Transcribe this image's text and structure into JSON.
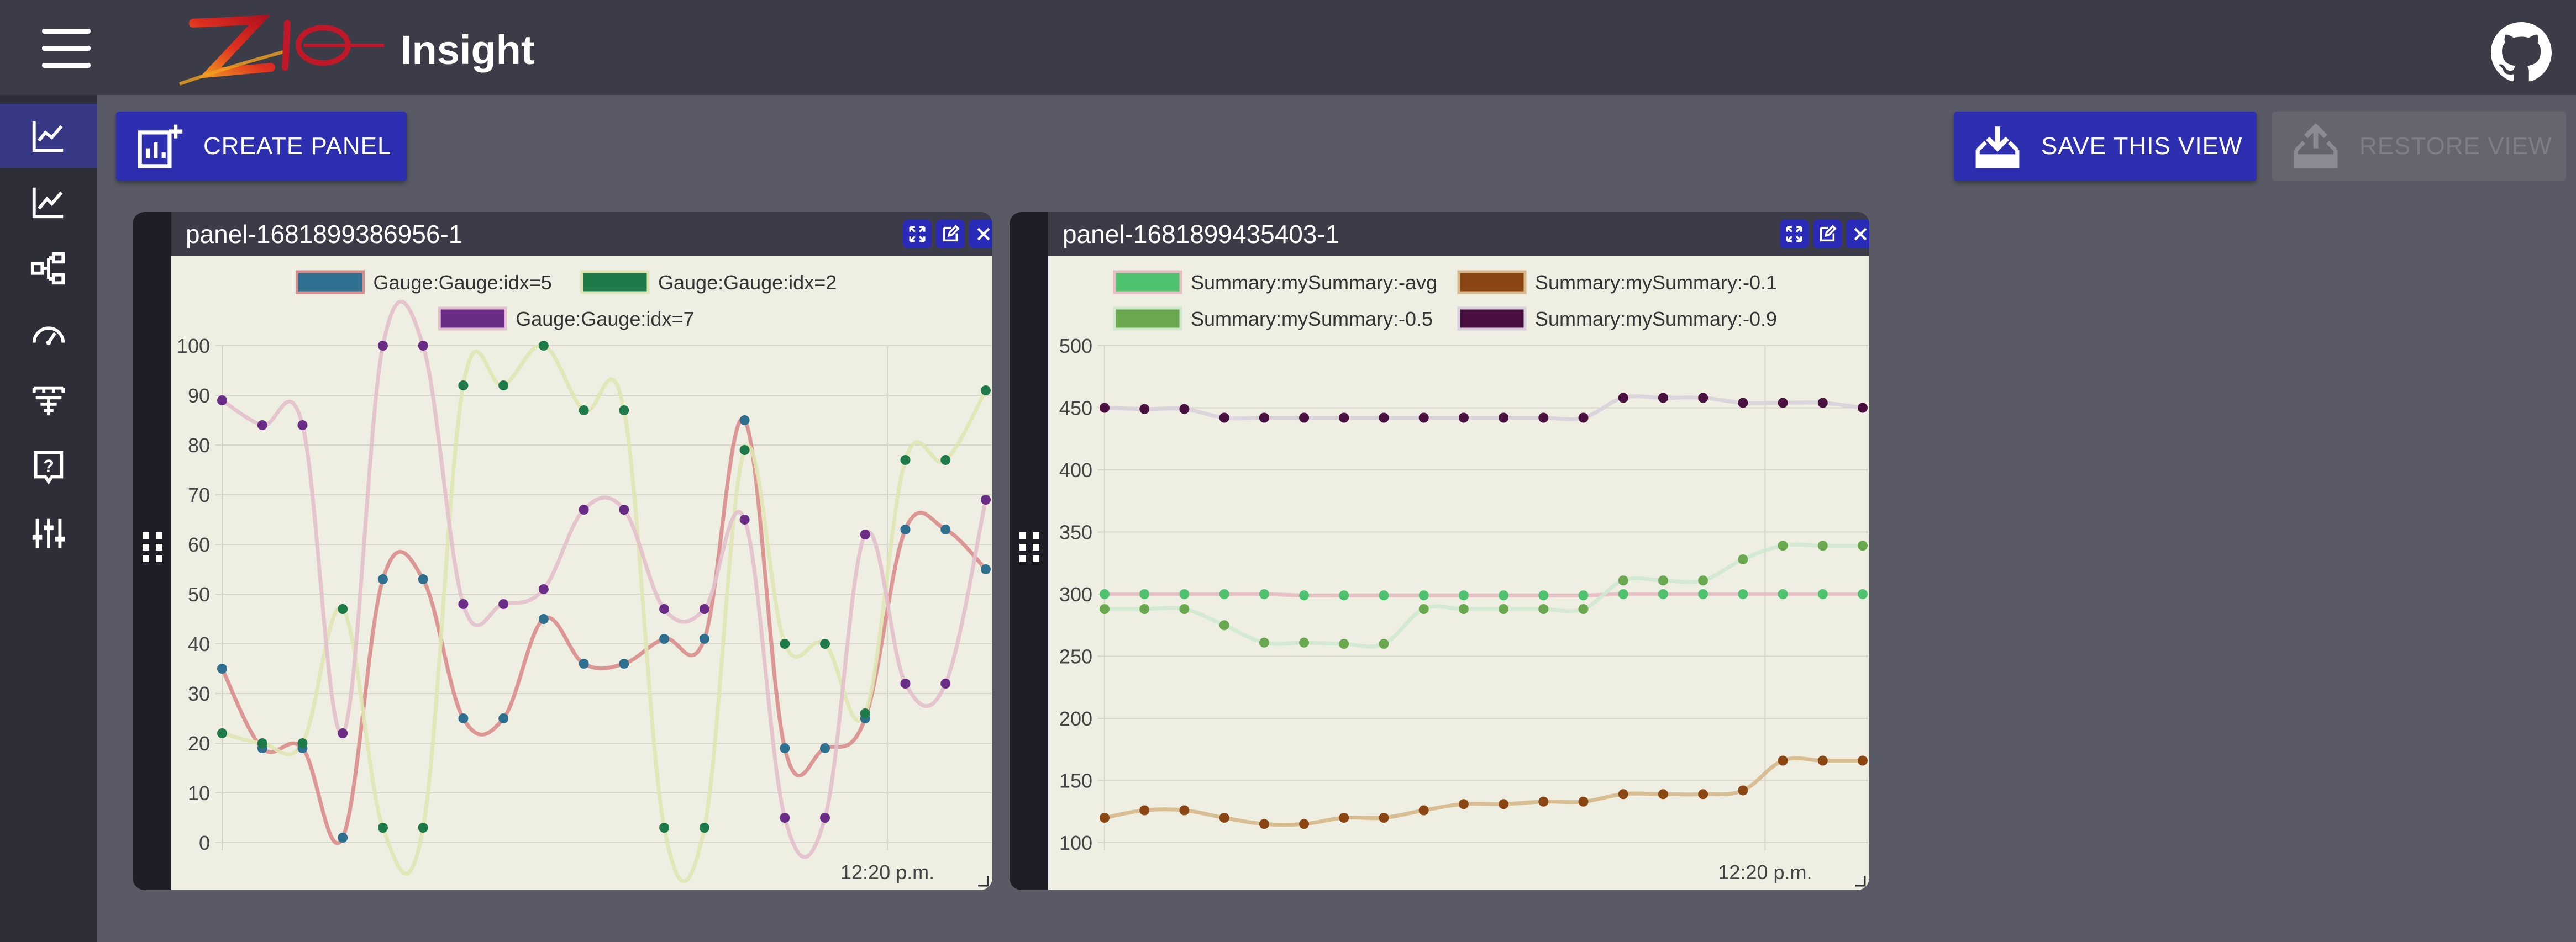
{
  "header": {
    "app_title": "Insight",
    "logo_text": "ZIO"
  },
  "sidebar": {
    "items": [
      {
        "icon": "line-chart-icon",
        "active": true
      },
      {
        "icon": "line-chart-icon",
        "active": false
      },
      {
        "icon": "hierarchy-icon",
        "active": false
      },
      {
        "icon": "gauge-icon",
        "active": false
      },
      {
        "icon": "tree-diagram-icon",
        "active": false
      },
      {
        "icon": "help-icon",
        "active": false
      },
      {
        "icon": "sliders-icon",
        "active": false
      }
    ]
  },
  "toolbar": {
    "create_panel": "CREATE PANEL",
    "save_view": "SAVE THIS VIEW",
    "restore_view": "RESTORE VIEW"
  },
  "colors": {
    "accent": "#2e2eb0",
    "topbar": "#3c3c48",
    "background": "#5a5a66",
    "chart_bg": "#eeeee2"
  },
  "panels": [
    {
      "title": "panel-1681899386956-1",
      "x_tick": "12:20 p.m."
    },
    {
      "title": "panel-1681899435403-1",
      "x_tick": "12:20 p.m."
    }
  ],
  "chart_data": [
    {
      "type": "line",
      "ylim": [
        0,
        100
      ],
      "y_ticks": [
        0,
        10,
        20,
        30,
        40,
        50,
        60,
        70,
        80,
        90,
        100
      ],
      "x_tick_labels": [
        "12:20 p.m."
      ],
      "grid": true,
      "legend_position": "top",
      "series": [
        {
          "name": "Gauge:Gauge:idx=5",
          "color": "#2f6f8f",
          "line_color": "#d98c8c",
          "values": [
            35,
            19,
            19,
            1,
            53,
            53,
            25,
            25,
            45,
            36,
            36,
            41,
            41,
            85,
            19,
            19,
            25,
            63,
            63,
            55
          ]
        },
        {
          "name": "Gauge:Gauge:idx=2",
          "color": "#1f7a4a",
          "line_color": "#dfe6b4",
          "values": [
            22,
            20,
            20,
            47,
            3,
            3,
            92,
            92,
            100,
            87,
            87,
            3,
            3,
            79,
            40,
            40,
            26,
            77,
            77,
            91
          ]
        },
        {
          "name": "Gauge:Gauge:idx=7",
          "color": "#6a2c86",
          "line_color": "#e2c0cc",
          "values": [
            89,
            84,
            84,
            22,
            100,
            100,
            48,
            48,
            51,
            67,
            67,
            47,
            47,
            65,
            5,
            5,
            62,
            32,
            32,
            69
          ]
        }
      ]
    },
    {
      "type": "line",
      "ylim": [
        100,
        500
      ],
      "y_ticks": [
        100,
        150,
        200,
        250,
        300,
        350,
        400,
        450,
        500
      ],
      "x_tick_labels": [
        "12:20 p.m."
      ],
      "grid": true,
      "legend_position": "top",
      "series": [
        {
          "name": "Summary:mySummary:-avg",
          "color": "#4ec26f",
          "line_color": "#e8bcc4",
          "values": [
            300,
            300,
            300,
            300,
            300,
            299,
            299,
            299,
            299,
            299,
            299,
            299,
            299,
            300,
            300,
            300,
            300,
            300,
            300,
            300
          ]
        },
        {
          "name": "Summary:mySummary:-0.1",
          "color": "#8b4513",
          "line_color": "#d6b88c",
          "values": [
            120,
            126,
            126,
            120,
            115,
            115,
            120,
            120,
            126,
            131,
            131,
            133,
            133,
            139,
            139,
            139,
            142,
            166,
            166,
            166
          ]
        },
        {
          "name": "Summary:mySummary:-0.5",
          "color": "#6aa84f",
          "line_color": "#cfe8cf",
          "values": [
            288,
            288,
            288,
            275,
            261,
            261,
            260,
            260,
            288,
            288,
            288,
            288,
            288,
            311,
            311,
            311,
            328,
            339,
            339,
            339
          ]
        },
        {
          "name": "Summary:mySummary:-0.9",
          "color": "#4a1040",
          "line_color": "#d8d0dc",
          "values": [
            450,
            449,
            449,
            442,
            442,
            442,
            442,
            442,
            442,
            442,
            442,
            442,
            442,
            458,
            458,
            458,
            454,
            454,
            454,
            450
          ]
        }
      ]
    }
  ]
}
